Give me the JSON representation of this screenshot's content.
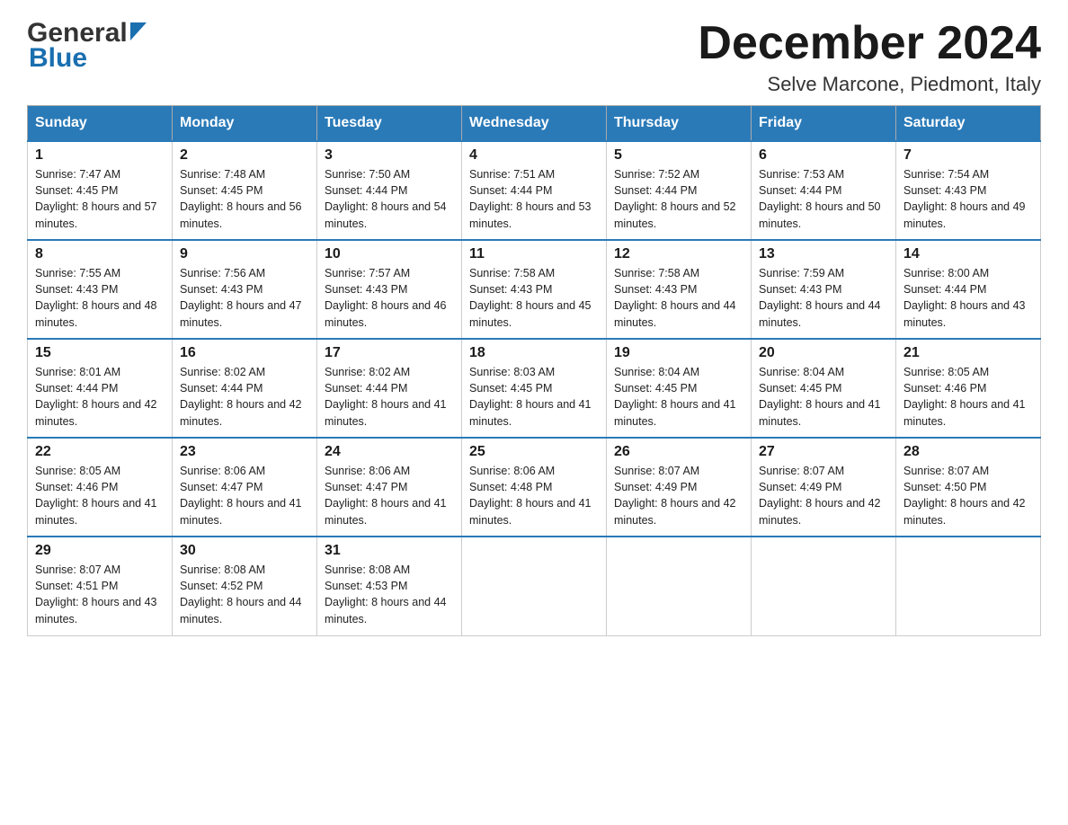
{
  "header": {
    "logo": {
      "general_text": "General",
      "blue_text": "Blue"
    },
    "title": "December 2024",
    "location": "Selve Marcone, Piedmont, Italy"
  },
  "calendar": {
    "days_of_week": [
      "Sunday",
      "Monday",
      "Tuesday",
      "Wednesday",
      "Thursday",
      "Friday",
      "Saturday"
    ],
    "weeks": [
      [
        {
          "day": "1",
          "sunrise": "7:47 AM",
          "sunset": "4:45 PM",
          "daylight": "8 hours and 57 minutes."
        },
        {
          "day": "2",
          "sunrise": "7:48 AM",
          "sunset": "4:45 PM",
          "daylight": "8 hours and 56 minutes."
        },
        {
          "day": "3",
          "sunrise": "7:50 AM",
          "sunset": "4:44 PM",
          "daylight": "8 hours and 54 minutes."
        },
        {
          "day": "4",
          "sunrise": "7:51 AM",
          "sunset": "4:44 PM",
          "daylight": "8 hours and 53 minutes."
        },
        {
          "day": "5",
          "sunrise": "7:52 AM",
          "sunset": "4:44 PM",
          "daylight": "8 hours and 52 minutes."
        },
        {
          "day": "6",
          "sunrise": "7:53 AM",
          "sunset": "4:44 PM",
          "daylight": "8 hours and 50 minutes."
        },
        {
          "day": "7",
          "sunrise": "7:54 AM",
          "sunset": "4:43 PM",
          "daylight": "8 hours and 49 minutes."
        }
      ],
      [
        {
          "day": "8",
          "sunrise": "7:55 AM",
          "sunset": "4:43 PM",
          "daylight": "8 hours and 48 minutes."
        },
        {
          "day": "9",
          "sunrise": "7:56 AM",
          "sunset": "4:43 PM",
          "daylight": "8 hours and 47 minutes."
        },
        {
          "day": "10",
          "sunrise": "7:57 AM",
          "sunset": "4:43 PM",
          "daylight": "8 hours and 46 minutes."
        },
        {
          "day": "11",
          "sunrise": "7:58 AM",
          "sunset": "4:43 PM",
          "daylight": "8 hours and 45 minutes."
        },
        {
          "day": "12",
          "sunrise": "7:58 AM",
          "sunset": "4:43 PM",
          "daylight": "8 hours and 44 minutes."
        },
        {
          "day": "13",
          "sunrise": "7:59 AM",
          "sunset": "4:43 PM",
          "daylight": "8 hours and 44 minutes."
        },
        {
          "day": "14",
          "sunrise": "8:00 AM",
          "sunset": "4:44 PM",
          "daylight": "8 hours and 43 minutes."
        }
      ],
      [
        {
          "day": "15",
          "sunrise": "8:01 AM",
          "sunset": "4:44 PM",
          "daylight": "8 hours and 42 minutes."
        },
        {
          "day": "16",
          "sunrise": "8:02 AM",
          "sunset": "4:44 PM",
          "daylight": "8 hours and 42 minutes."
        },
        {
          "day": "17",
          "sunrise": "8:02 AM",
          "sunset": "4:44 PM",
          "daylight": "8 hours and 41 minutes."
        },
        {
          "day": "18",
          "sunrise": "8:03 AM",
          "sunset": "4:45 PM",
          "daylight": "8 hours and 41 minutes."
        },
        {
          "day": "19",
          "sunrise": "8:04 AM",
          "sunset": "4:45 PM",
          "daylight": "8 hours and 41 minutes."
        },
        {
          "day": "20",
          "sunrise": "8:04 AM",
          "sunset": "4:45 PM",
          "daylight": "8 hours and 41 minutes."
        },
        {
          "day": "21",
          "sunrise": "8:05 AM",
          "sunset": "4:46 PM",
          "daylight": "8 hours and 41 minutes."
        }
      ],
      [
        {
          "day": "22",
          "sunrise": "8:05 AM",
          "sunset": "4:46 PM",
          "daylight": "8 hours and 41 minutes."
        },
        {
          "day": "23",
          "sunrise": "8:06 AM",
          "sunset": "4:47 PM",
          "daylight": "8 hours and 41 minutes."
        },
        {
          "day": "24",
          "sunrise": "8:06 AM",
          "sunset": "4:47 PM",
          "daylight": "8 hours and 41 minutes."
        },
        {
          "day": "25",
          "sunrise": "8:06 AM",
          "sunset": "4:48 PM",
          "daylight": "8 hours and 41 minutes."
        },
        {
          "day": "26",
          "sunrise": "8:07 AM",
          "sunset": "4:49 PM",
          "daylight": "8 hours and 42 minutes."
        },
        {
          "day": "27",
          "sunrise": "8:07 AM",
          "sunset": "4:49 PM",
          "daylight": "8 hours and 42 minutes."
        },
        {
          "day": "28",
          "sunrise": "8:07 AM",
          "sunset": "4:50 PM",
          "daylight": "8 hours and 42 minutes."
        }
      ],
      [
        {
          "day": "29",
          "sunrise": "8:07 AM",
          "sunset": "4:51 PM",
          "daylight": "8 hours and 43 minutes."
        },
        {
          "day": "30",
          "sunrise": "8:08 AM",
          "sunset": "4:52 PM",
          "daylight": "8 hours and 44 minutes."
        },
        {
          "day": "31",
          "sunrise": "8:08 AM",
          "sunset": "4:53 PM",
          "daylight": "8 hours and 44 minutes."
        },
        null,
        null,
        null,
        null
      ]
    ]
  }
}
